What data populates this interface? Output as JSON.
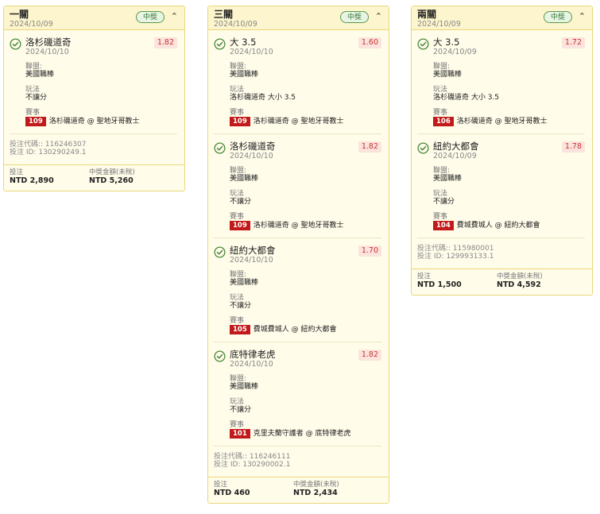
{
  "common": {
    "win_badge": "中獎",
    "league_label": "聯盟:",
    "play_label": "玩法",
    "event_label": "賽事",
    "stake_label": "投注",
    "payout_label": "中獎金額(未稅)"
  },
  "cards": [
    {
      "title": "一關",
      "date": "2024/10/09",
      "legs": [
        {
          "name": "洛杉磯道奇",
          "date": "2024/10/10",
          "odds": "1.82",
          "league": "美國職棒",
          "play": "不讓分",
          "match_no": "109",
          "match": "洛杉磯道奇 @ 聖地牙哥教士"
        }
      ],
      "bet_code": "投注代碼:: 116246307",
      "bet_id": "投注 ID: 130290249.1",
      "stake": "NTD 2,890",
      "payout": "NTD 5,260"
    },
    {
      "title": "三關",
      "date": "2024/10/09",
      "legs": [
        {
          "name": "大 3.5",
          "date": "2024/10/10",
          "odds": "1.60",
          "league": "美國職棒",
          "play": "洛杉磯道奇 大小 3.5",
          "match_no": "109",
          "match": "洛杉磯道奇 @ 聖地牙哥教士"
        },
        {
          "name": "洛杉磯道奇",
          "date": "2024/10/10",
          "odds": "1.82",
          "league": "美國職棒",
          "play": "不讓分",
          "match_no": "109",
          "match": "洛杉磯道奇 @ 聖地牙哥教士"
        },
        {
          "name": "紐約大都會",
          "date": "2024/10/10",
          "odds": "1.70",
          "league": "美國職棒",
          "play": "不讓分",
          "match_no": "105",
          "match": "費城費城人 @ 紐約大都會"
        },
        {
          "name": "底特律老虎",
          "date": "2024/10/10",
          "odds": "1.82",
          "league": "美國職棒",
          "play": "不讓分",
          "match_no": "101",
          "match": "克里夫蘭守護者 @ 底特律老虎"
        }
      ],
      "bet_code": "投注代碼:: 116246111",
      "bet_id": "投注 ID: 130290002.1",
      "stake": "NTD 460",
      "payout": "NTD 2,434"
    },
    {
      "title": "兩關",
      "date": "2024/10/09",
      "legs": [
        {
          "name": "大 3.5",
          "date": "2024/10/09",
          "odds": "1.72",
          "league": "美國職棒",
          "play": "洛杉磯道奇 大小 3.5",
          "match_no": "106",
          "match": "洛杉磯道奇 @ 聖地牙哥教士"
        },
        {
          "name": "紐約大都會",
          "date": "2024/10/09",
          "odds": "1.78",
          "league": "美國職棒",
          "play": "不讓分",
          "match_no": "104",
          "match": "費城費城人 @ 紐約大都會"
        }
      ],
      "bet_code": "投注代碼:: 115980001",
      "bet_id": "投注 ID: 129993133.1",
      "stake": "NTD 1,500",
      "payout": "NTD 4,592"
    }
  ]
}
